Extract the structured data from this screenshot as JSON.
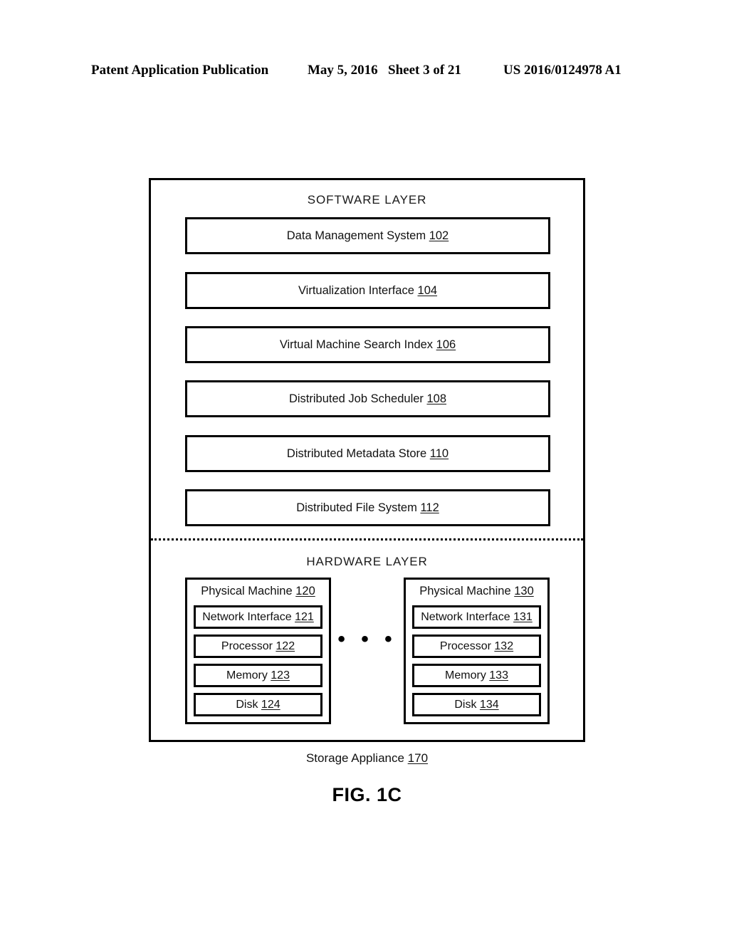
{
  "header": {
    "publication": "Patent Application Publication",
    "date": "May 5, 2016",
    "sheet": "Sheet 3 of 21",
    "patent_number": "US 2016/0124978 A1"
  },
  "figure": {
    "caption": "FIG. 1C",
    "appliance_label": "Storage Appliance",
    "appliance_ref": "170"
  },
  "diagram": {
    "software_layer": {
      "title": "SOFTWARE LAYER",
      "components": [
        {
          "label": "Data Management System",
          "ref": "102"
        },
        {
          "label": "Virtualization Interface",
          "ref": "104"
        },
        {
          "label": "Virtual Machine Search Index",
          "ref": "106"
        },
        {
          "label": "Distributed Job Scheduler",
          "ref": "108"
        },
        {
          "label": "Distributed Metadata Store",
          "ref": "110"
        },
        {
          "label": "Distributed File System",
          "ref": "112"
        }
      ]
    },
    "hardware_layer": {
      "title": "HARDWARE LAYER",
      "ellipsis": "• • •",
      "machines": [
        {
          "title": "Physical Machine",
          "ref": "120",
          "components": [
            {
              "label": "Network Interface",
              "ref": "121"
            },
            {
              "label": "Processor",
              "ref": "122"
            },
            {
              "label": "Memory",
              "ref": "123"
            },
            {
              "label": "Disk",
              "ref": "124"
            }
          ]
        },
        {
          "title": "Physical Machine",
          "ref": "130",
          "components": [
            {
              "label": "Network Interface",
              "ref": "131"
            },
            {
              "label": "Processor",
              "ref": "132"
            },
            {
              "label": "Memory",
              "ref": "133"
            },
            {
              "label": "Disk",
              "ref": "134"
            }
          ]
        }
      ]
    }
  },
  "colors": {
    "ink": "#000000",
    "paper": "#ffffff"
  }
}
